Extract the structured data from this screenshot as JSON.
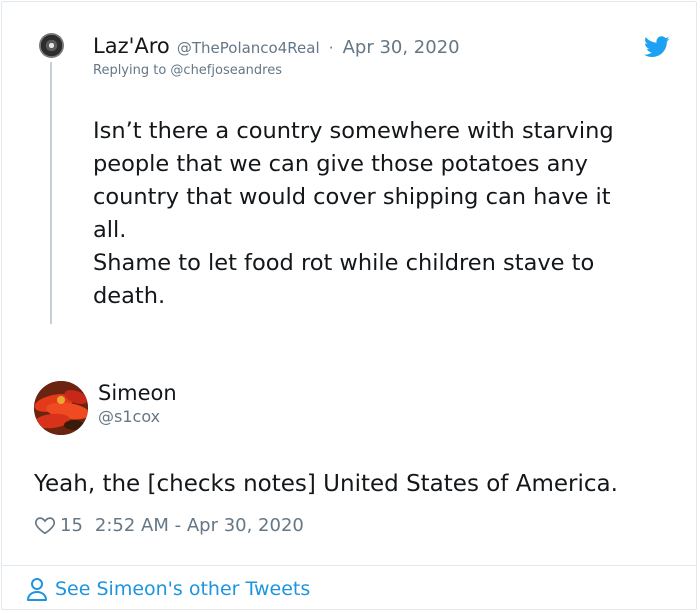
{
  "reply_tweet": {
    "name": "Laz'Aro",
    "handle": "@ThePolanco4Real",
    "separator": "·",
    "date": "Apr 30, 2020",
    "replying_to": "Replying to @chefjoseandres",
    "text": "Isn’t there a country somewhere with starving\npeople that we can give those potatoes any\ncountry that would cover shipping can have it\nall.\nShame to let food rot while children stave to\ndeath."
  },
  "main_tweet": {
    "name": "Simeon",
    "handle": "@s1cox",
    "text": "Yeah, the [checks notes] United States of America.",
    "likes": "15",
    "timestamp": "2:52 AM - Apr 30, 2020"
  },
  "footer": {
    "link_text": "See Simeon's other Tweets"
  },
  "icons": [
    "twitter-bird-icon",
    "heart-icon",
    "person-icon"
  ],
  "colors": {
    "twitter_blue": "#1da1f2",
    "link_blue": "#1b95e0",
    "secondary_text": "#657786",
    "border": "#e1e8ed"
  }
}
